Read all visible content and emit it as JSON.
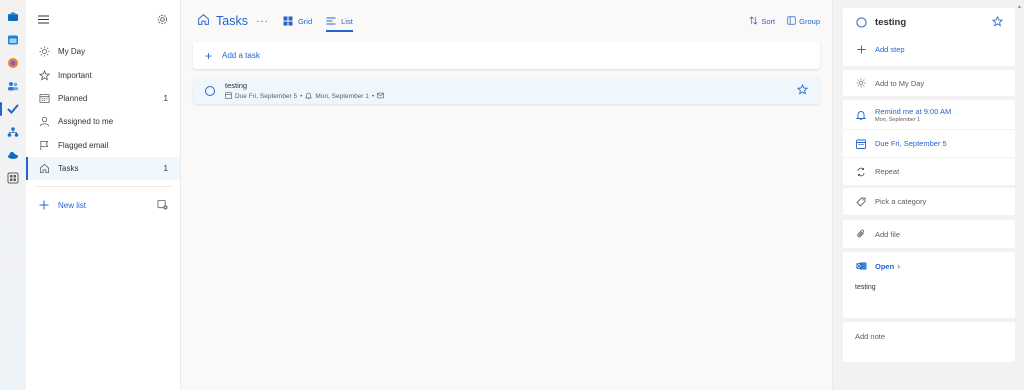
{
  "rail": {
    "icons": [
      "mail-icon",
      "calendar-icon",
      "office-icon",
      "people-icon",
      "todo-icon",
      "org-icon",
      "onedrive-icon",
      "apps-icon"
    ]
  },
  "sidebar": {
    "items": [
      {
        "label": "My Day",
        "icon": "sun-icon",
        "count": ""
      },
      {
        "label": "Important",
        "icon": "star-icon",
        "count": ""
      },
      {
        "label": "Planned",
        "icon": "calendar-icon",
        "count": "1"
      },
      {
        "label": "Assigned to me",
        "icon": "person-icon",
        "count": ""
      },
      {
        "label": "Flagged email",
        "icon": "flag-icon",
        "count": ""
      },
      {
        "label": "Tasks",
        "icon": "home-icon",
        "count": "1"
      }
    ],
    "new_list": "New list"
  },
  "main": {
    "title": "Tasks",
    "more": "···",
    "views": [
      {
        "label": "Grid"
      },
      {
        "label": "List"
      }
    ],
    "sort": "Sort",
    "group": "Group",
    "add_task": "Add a task",
    "task": {
      "name": "testing",
      "due": "Due Fri, September 5",
      "reminder": "Mon, September 1",
      "dot": "•"
    }
  },
  "detail": {
    "title": "testing",
    "add_step": "Add step",
    "add_my_day": "Add to My Day",
    "remind": "Remind me at 9:00 AM",
    "remind_sub": "Mon, September 1",
    "due": "Due Fri, September 5",
    "repeat": "Repeat",
    "category": "Pick a category",
    "add_file": "Add file",
    "open": "Open",
    "open_chevron": "›",
    "linked_text": "testing",
    "add_note": "Add note"
  },
  "colors": {
    "accent": "#2564cf",
    "selected_bg": "#eff6fc",
    "page_bg": "#faf9f8"
  }
}
